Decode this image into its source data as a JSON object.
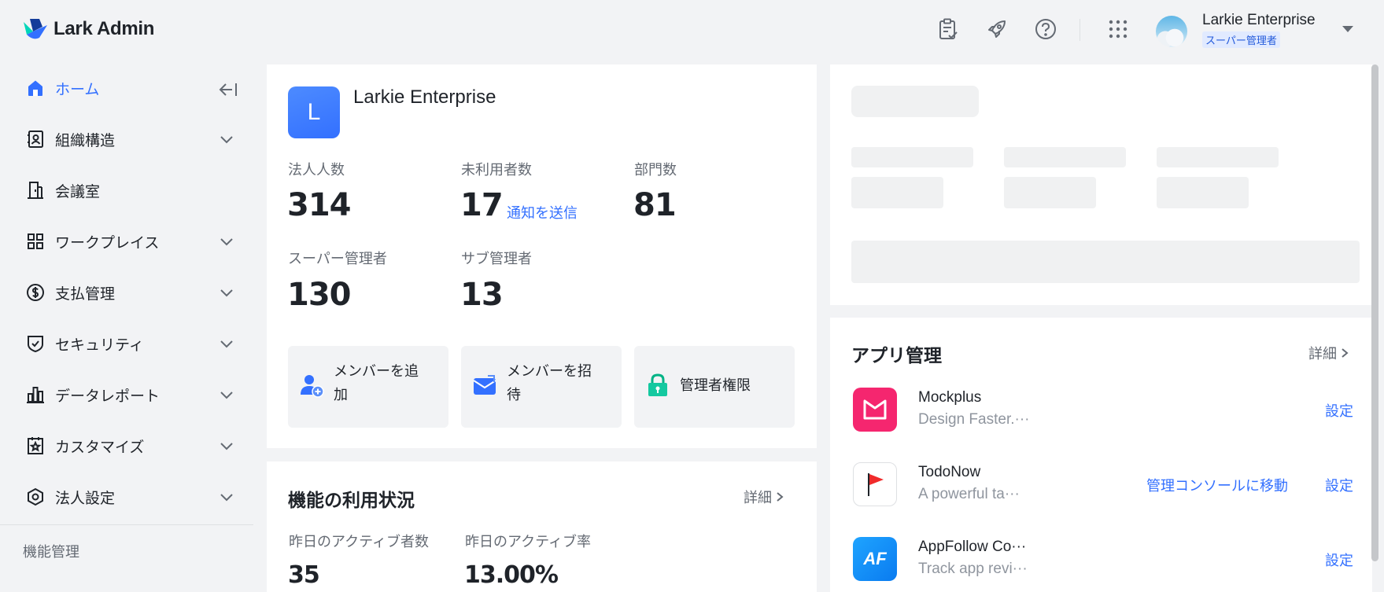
{
  "header": {
    "app_name": "Lark Admin",
    "user_name": "Larkie Enterprise",
    "user_role": "スーパー管理者",
    "icons": [
      "checklist-icon",
      "rocket-icon",
      "help-icon",
      "apps-grid-icon"
    ]
  },
  "sidebar": {
    "items": [
      {
        "label": "ホーム",
        "icon": "home-icon",
        "active": true
      },
      {
        "label": "組織構造",
        "icon": "contacts-icon"
      },
      {
        "label": "会議室",
        "icon": "door-icon"
      },
      {
        "label": "ワークプレイス",
        "icon": "grid-icon"
      },
      {
        "label": "支払管理",
        "icon": "dollar-icon"
      },
      {
        "label": "セキュリティ",
        "icon": "shield-icon"
      },
      {
        "label": "データレポート",
        "icon": "bar-chart-icon"
      },
      {
        "label": "カスタマイズ",
        "icon": "star-box-icon"
      },
      {
        "label": "法人設定",
        "icon": "hex-settings-icon"
      }
    ],
    "footer": "機能管理"
  },
  "enterprise": {
    "initial": "L",
    "name": "Larkie Enterprise",
    "stats": {
      "corp_users_label": "法人人数",
      "corp_users": "314",
      "inactive_label": "未利用者数",
      "inactive": "17",
      "notify_link": "通知を送信",
      "departments_label": "部門数",
      "departments": "81",
      "super_admins_label": "スーパー管理者",
      "super_admins": "130",
      "sub_admins_label": "サブ管理者",
      "sub_admins": "13"
    },
    "actions": {
      "add_member_1": "メンバーを追",
      "add_member_2": "加",
      "invite_member_1": "メンバーを招",
      "invite_member_2": "待",
      "admin_perms": "管理者権限"
    }
  },
  "usage": {
    "title": "機能の利用状況",
    "detail": "詳細",
    "active_users_label": "昨日のアクティブ者数",
    "active_users": "35",
    "active_rate_label": "昨日のアクティブ率",
    "active_rate": "13.00%"
  },
  "apps": {
    "title": "アプリ管理",
    "detail": "詳細",
    "items": [
      {
        "name": "Mockplus",
        "desc": "Design Faster.···",
        "console": "",
        "settings": "設定"
      },
      {
        "name": "TodoNow",
        "desc": "A powerful ta···",
        "console": "管理コンソールに移動",
        "settings": "設定"
      },
      {
        "name": "AppFollow Co···",
        "desc": "Track app revi···",
        "console": "",
        "settings": "設定",
        "icon_text": "AF"
      }
    ]
  }
}
